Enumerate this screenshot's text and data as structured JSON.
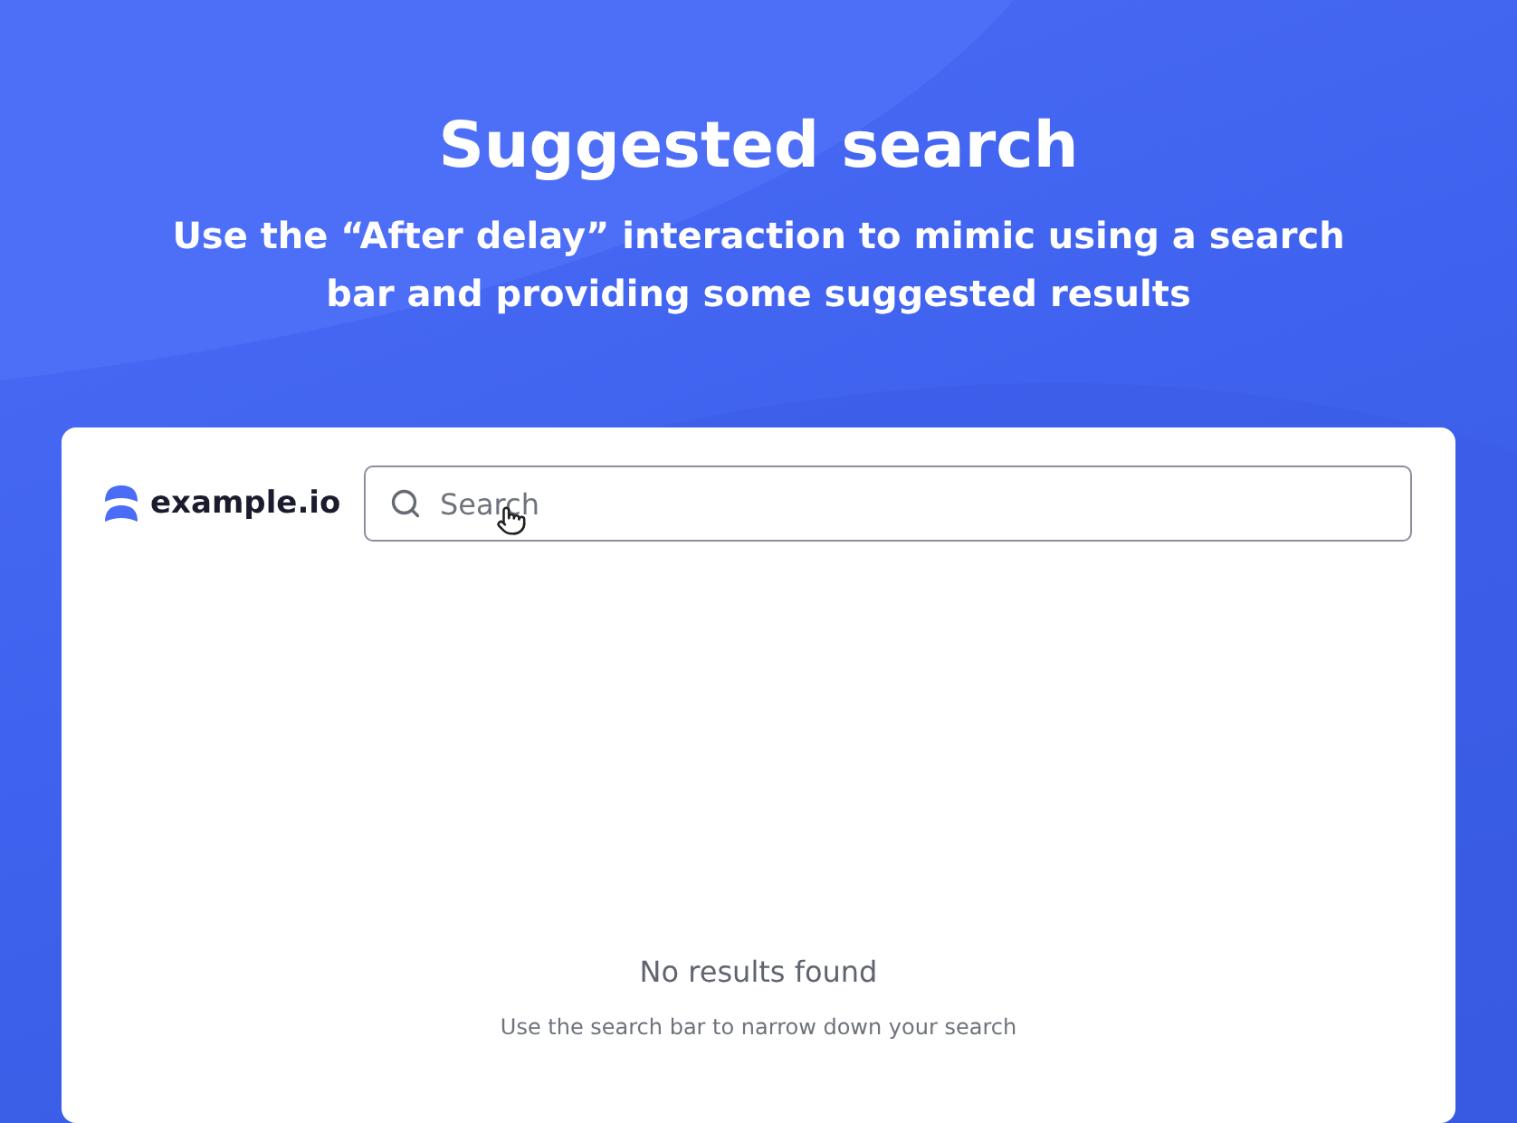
{
  "header": {
    "title": "Suggested search",
    "subtitle": "Use the “After delay” interaction to mimic using a search bar and providing some suggested results"
  },
  "app": {
    "logo_text": "example.io",
    "search": {
      "placeholder": "Search"
    },
    "empty_state": {
      "title": "No results found",
      "message": "Use the search bar to narrow down your search"
    }
  }
}
